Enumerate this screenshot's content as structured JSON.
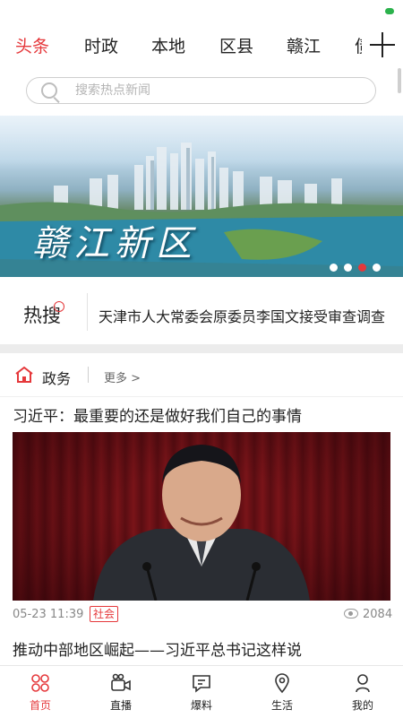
{
  "tabs": [
    "头条",
    "时政",
    "本地",
    "区县",
    "赣江",
    "..."
  ],
  "tab_overflow_glyph": "债",
  "search": {
    "placeholder": "搜索热点新闻"
  },
  "banner": {
    "title": "赣江新区",
    "slide_count": 4,
    "active_slide": 3
  },
  "hot": {
    "label": "热搜",
    "text": "天津市人大常委会原委员李国文接受审查调查"
  },
  "section": {
    "title": "政务",
    "more": "更多 >"
  },
  "article": {
    "title": "习近平：最重要的还是做好我们自己的事情",
    "time": "05-23 11:39",
    "tag": "社会",
    "views": "2084"
  },
  "article2": {
    "title": "推动中部地区崛起——习近平总书记这样说"
  },
  "bottom_nav": [
    {
      "label": "首页",
      "icon": "home-grid-icon",
      "active": true
    },
    {
      "label": "直播",
      "icon": "video-camera-icon",
      "active": false
    },
    {
      "label": "爆料",
      "icon": "chat-bubble-icon",
      "active": false
    },
    {
      "label": "生活",
      "icon": "location-pin-icon",
      "active": false
    },
    {
      "label": "我的",
      "icon": "user-icon",
      "active": false
    }
  ],
  "colors": {
    "accent": "#e5383b",
    "text": "#222222",
    "muted": "#888888",
    "divider": "#ececec"
  }
}
